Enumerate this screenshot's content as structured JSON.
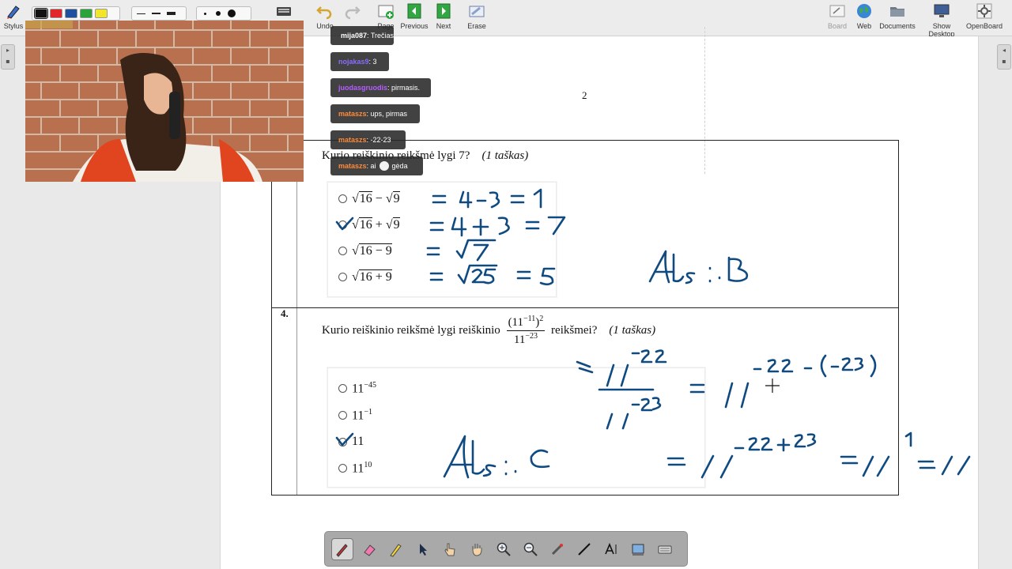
{
  "toolbar": {
    "stylus_label": "Stylus",
    "undo_label": "Undo",
    "redo_label": "",
    "add_page_label": "Page",
    "previous_label": "Previous",
    "next_label": "Next",
    "erase_label": "Erase",
    "board_label": "Board",
    "web_label": "Web",
    "documents_label": "Documents",
    "show_desktop_label": "Show Desktop",
    "openboard_label": "OpenBoard",
    "colors": [
      "#111111",
      "#e0262b",
      "#1f4fa0",
      "#2aa33a",
      "#f2e62a"
    ]
  },
  "page": {
    "number": "2"
  },
  "question3": {
    "prompt": "Kurio reiškinio reikšmė lygi 7?",
    "points": "(1 taškas)",
    "options": [
      {
        "expr_a": "16",
        "op": "−",
        "expr_b": "9"
      },
      {
        "expr_a": "16",
        "op": "+",
        "expr_b": "9"
      },
      {
        "single": "16 − 9"
      },
      {
        "single": "16 + 9"
      }
    ]
  },
  "question4": {
    "number": "4.",
    "prompt_start": "Kurio reiškinio reikšmė lygi reiškinio",
    "frac_num": "(11",
    "frac_num_exp": "−11",
    "frac_num_close": ")",
    "frac_num_pow": "2",
    "frac_den": "11",
    "frac_den_exp": "−23",
    "prompt_end": "reikšmei?",
    "points": "(1 taškas)",
    "options": [
      {
        "base": "11",
        "exp": "−45"
      },
      {
        "base": "11",
        "exp": "−1"
      },
      {
        "base": "11",
        "exp": ""
      },
      {
        "base": "11",
        "exp": "10"
      }
    ]
  },
  "handwriting": {
    "q3_line1": "= 4 - 3 = 1",
    "q3_line2": "= 4 + 3 = 7",
    "q3_line3": "= √7",
    "q3_line4": "= √25 = 5",
    "q3_answer": "Ats. : B",
    "q4_step": "= 11^-22 / 11^-23 = 11^-22-(-23)",
    "q4_step2": "= 11^-22+23 = 11^1 = 11",
    "q4_answer": "Ats. : C"
  },
  "chat": [
    {
      "user": "mija087",
      "user_color": "#ffffff",
      "message": ": Trečias",
      "badge": true
    },
    {
      "user": "nojakas9",
      "user_color": "#8a6bff",
      "message": ": 3",
      "badge": false
    },
    {
      "user": "juodasgruodis",
      "user_color": "#b65cff",
      "message": ": pirmasis.",
      "badge": false
    },
    {
      "user": "mataszs",
      "user_color": "#ff8a3a",
      "message": ": ups, pirmas",
      "badge": false
    },
    {
      "user": "mataszs",
      "user_color": "#ff8a3a",
      "message": ": -22-23",
      "badge": false
    },
    {
      "user": "mataszs",
      "user_color": "#ff8a3a",
      "message": ": ai",
      "message2": "gėda",
      "badge": false
    }
  ],
  "bottom_tools": [
    "pen-tool",
    "eraser-tool",
    "marker-tool",
    "selector-tool",
    "interact-tool",
    "hand-tool",
    "zoom-in-tool",
    "zoom-out-tool",
    "laser-pointer-tool",
    "line-tool",
    "text-tool",
    "capture-tool",
    "virtual-keyboard-tool"
  ]
}
